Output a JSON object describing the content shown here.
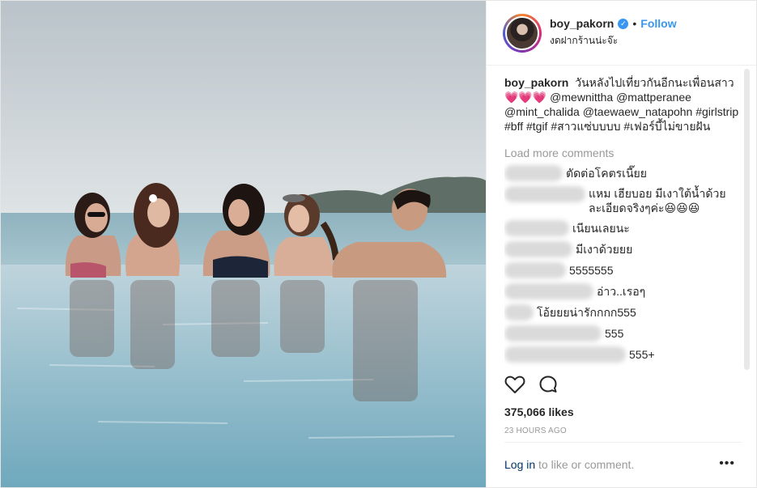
{
  "post": {
    "username": "boy_pakorn",
    "follow_label": "Follow",
    "separator": "•",
    "location": "งดฝากร้านน่ะจ๊ะ",
    "caption": {
      "username": "boy_pakorn",
      "text": "วันหลังไปเที่ยวกันอีกนะเพื่อนสาว 💗💗💗 @mewnittha @mattperanee @mint_chalida @taewaew_natapohn #girlstrip #bff #tgif #สาวแซ่บบบบ #เฟอร์บี้ไม่ขายฝัน"
    },
    "load_more_label": "Load more comments",
    "comments": [
      {
        "text": "ตัดต่อโคตรเนี๊ยย"
      },
      {
        "text": "แหม เฮียบอย มีเงาใต้น้ำด้วย ละเอียดจริงๆค่ะ😆😆😆"
      },
      {
        "text": "เนียนเลยนะ"
      },
      {
        "text": "มีเงาด้วยยย"
      },
      {
        "text": "5555555"
      },
      {
        "text": "อ่าว..เรอๆ"
      },
      {
        "text": "โอ้ยยยน่ารักกกก555"
      },
      {
        "text": "555"
      },
      {
        "text": "555+"
      }
    ],
    "likes": "375,066 likes",
    "time": "23 HOURS AGO",
    "login_link": "Log in",
    "login_rest": " to like or comment.",
    "more_label": "•••"
  },
  "colors": {
    "link_blue": "#3897f0",
    "text": "#262626",
    "muted": "#999999",
    "border": "#efefef"
  },
  "icons": [
    "heart-icon",
    "comment-icon",
    "verified-icon",
    "more-options-icon"
  ]
}
